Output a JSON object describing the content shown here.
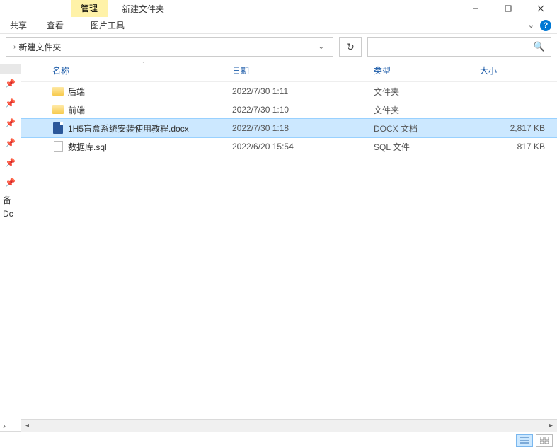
{
  "titlebar": {
    "manage_tab": "管理",
    "title": "新建文件夹",
    "picture_tools": "图片工具",
    "share_tab": "共享",
    "view_tab": "查看"
  },
  "breadcrumb": {
    "location": "新建文件夹"
  },
  "columns": {
    "name": "名称",
    "date": "日期",
    "type": "类型",
    "size": "大小"
  },
  "files": [
    {
      "name": "后端",
      "date": "2022/7/30 1:11",
      "type": "文件夹",
      "size": "",
      "icon": "folder",
      "selected": false
    },
    {
      "name": "前端",
      "date": "2022/7/30 1:10",
      "type": "文件夹",
      "size": "",
      "icon": "folder",
      "selected": false
    },
    {
      "name": "1H5盲盒系统安装使用教程.docx",
      "date": "2022/7/30 1:18",
      "type": "DOCX 文档",
      "size": "2,817 KB",
      "icon": "docx",
      "selected": true
    },
    {
      "name": "数据库.sql",
      "date": "2022/6/20 15:54",
      "type": "SQL 文件",
      "size": "817 KB",
      "icon": "file",
      "selected": false
    }
  ],
  "sidebar": {
    "label1": "备",
    "label2": "Dc"
  }
}
